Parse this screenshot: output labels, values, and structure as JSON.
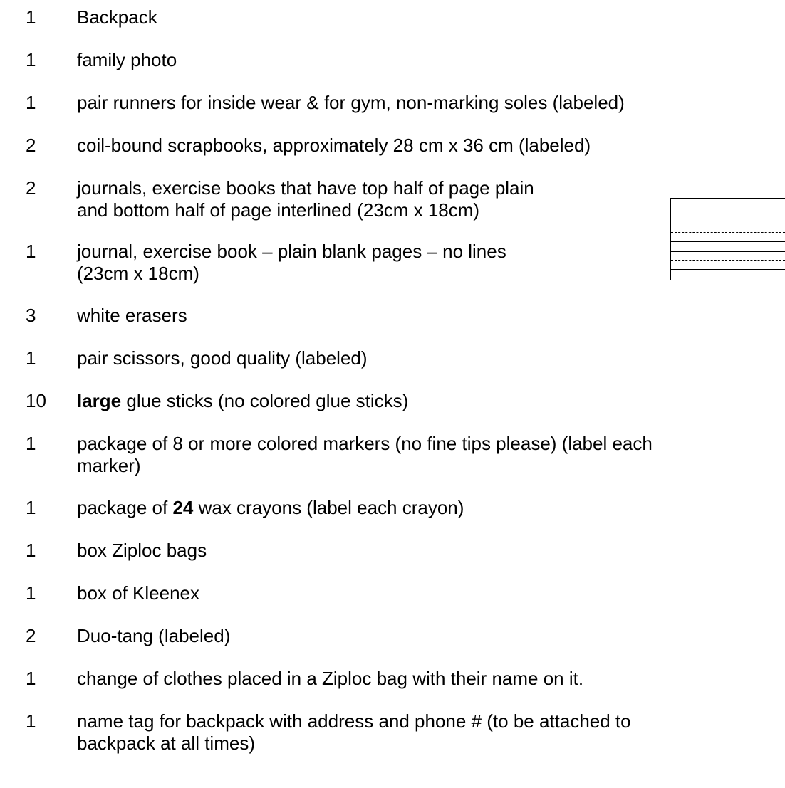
{
  "items": [
    {
      "qty": "1",
      "lines": [
        "Backpack"
      ]
    },
    {
      "qty": "1",
      "lines": [
        "family photo"
      ]
    },
    {
      "qty": "1",
      "lines": [
        "pair runners for inside wear & for gym, non-marking soles (labeled)"
      ]
    },
    {
      "qty": "2",
      "lines": [
        "coil-bound scrapbooks, approximately 28 cm x 36 cm (labeled)"
      ]
    },
    {
      "qty": "2",
      "lines": [
        "journals, exercise books that have top half of page plain",
        "and bottom half of page interlined (23cm x 18cm)"
      ]
    },
    {
      "qty": "1",
      "lines": [
        "journal, exercise book – plain blank pages – no lines",
        "(23cm x 18cm)"
      ]
    },
    {
      "qty": "3",
      "lines": [
        "white erasers"
      ]
    },
    {
      "qty": "1",
      "lines": [
        "pair scissors, good quality (labeled)"
      ]
    },
    {
      "qty": "10",
      "bold": "large",
      "rest": " glue sticks (no colored glue sticks)"
    },
    {
      "qty": "1",
      "lines": [
        "package of 8 or more colored markers (no fine tips please) (label each",
        "marker)"
      ]
    },
    {
      "qty": "1",
      "pre": "package of ",
      "bold": "24",
      "rest": " wax crayons (label each crayon)"
    },
    {
      "qty": "1",
      "lines": [
        "box Ziploc bags"
      ]
    },
    {
      "qty": "1",
      "lines": [
        "box of Kleenex"
      ]
    },
    {
      "qty": "2",
      "lines": [
        "Duo-tang (labeled)"
      ]
    },
    {
      "qty": "1",
      "lines": [
        "change of clothes placed in a Ziploc bag with their name on it."
      ]
    },
    {
      "qty": "1",
      "lines": [
        "name tag for backpack with address and phone # (to be attached to",
        "backpack at all times)"
      ]
    }
  ]
}
